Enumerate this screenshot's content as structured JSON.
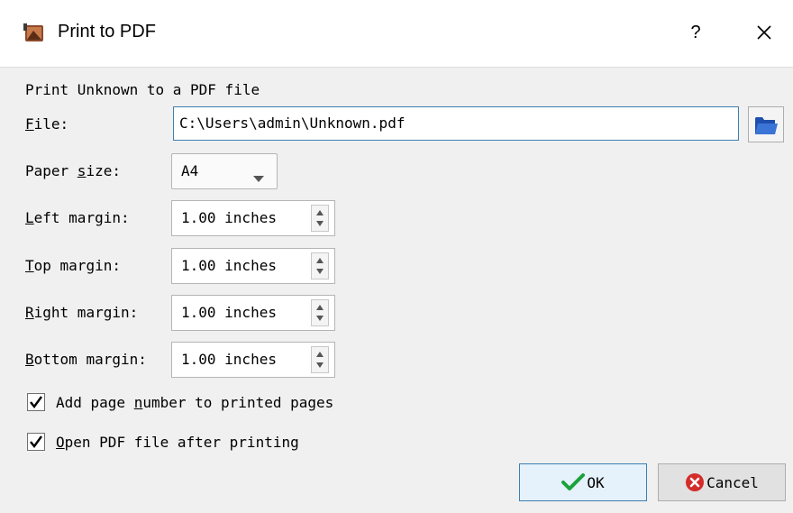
{
  "window": {
    "title": "Print to PDF",
    "help_label": "?"
  },
  "heading": "Print Unknown to a PDF file",
  "file": {
    "label_key": "F",
    "label_rest": "ile:",
    "value": "C:\\Users\\admin\\Unknown.pdf"
  },
  "paper": {
    "label_pre": "Paper ",
    "label_key": "s",
    "label_rest": "ize:",
    "selected": "A4"
  },
  "margins": {
    "left": {
      "label_key": "L",
      "label_rest": "eft margin:",
      "value": "1.00 inches"
    },
    "top": {
      "label_key": "T",
      "label_rest": "op margin:",
      "value": "1.00 inches"
    },
    "right": {
      "label_key": "R",
      "label_rest": "ight margin:",
      "value": "1.00 inches"
    },
    "bottom": {
      "label_key": "B",
      "label_rest": "ottom margin:",
      "value": "1.00 inches"
    }
  },
  "options": {
    "page_numbers": {
      "pre": "Add page ",
      "key": "n",
      "rest": "umber to printed pages",
      "checked": true
    },
    "open_after": {
      "pre": "",
      "key": "O",
      "rest": "pen PDF file after printing",
      "checked": true
    }
  },
  "buttons": {
    "ok": "OK",
    "cancel": "Cancel"
  },
  "colors": {
    "accent": "#3c7fb1",
    "ok_check": "#1aa33a",
    "cancel_red": "#d42b2b"
  }
}
